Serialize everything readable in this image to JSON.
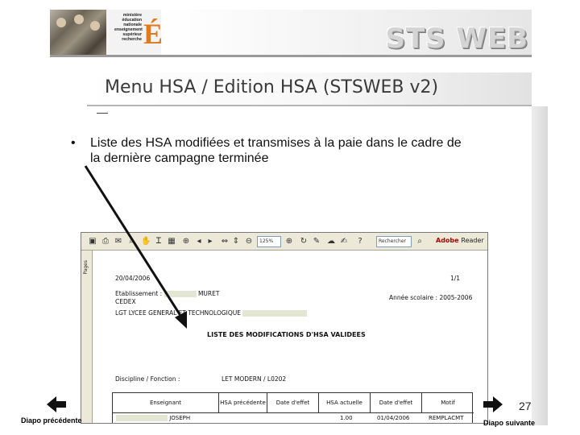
{
  "header": {
    "ministry_lines": [
      "ministère",
      "éducation",
      "nationale",
      "enseignement",
      "supérieur",
      "recherche"
    ],
    "ministry_letter": "É",
    "logo_text": "STS WEB"
  },
  "slide": {
    "title": "Menu HSA / Edition HSA (STSWEB v2)",
    "bullet": "Liste des HSA modifiées et transmises à la paie dans le cadre de la dernière campagne terminée",
    "page_number": "27"
  },
  "viewer": {
    "search_box": "Rechercher",
    "zoom_box": "125%",
    "adobe_brand": "Adobe",
    "adobe_reader": "Reader",
    "side_tab": "Pages"
  },
  "document": {
    "date": "20/04/2006",
    "page": "1/1",
    "etablissement_label": "Etablissement :",
    "etablissement_value": "MURET",
    "city": "CEDEX",
    "lycee": "LGT LYCEE GENERAL ET TECHNOLOGIQUE",
    "annee_label": "Année scolaire : 2005-2006",
    "title": "LISTE DES MODIFICATIONS D'HSA VALIDEES",
    "discipline_label": "Discipline / Fonction :",
    "discipline_value": "LET MODERN / L0202",
    "columns": [
      "Enseignant",
      "HSA précédente",
      "Date d'effet",
      "HSA actuelle",
      "Date d'effet",
      "Motif"
    ],
    "row": {
      "enseignant": "JOSEPH",
      "hsa_actuelle": "1.00",
      "date_effet": "01/04/2006",
      "motif": "REMPLACMT"
    }
  },
  "nav": {
    "prev_label": "Diapo précédente",
    "next_label": "Diapo suivante"
  }
}
